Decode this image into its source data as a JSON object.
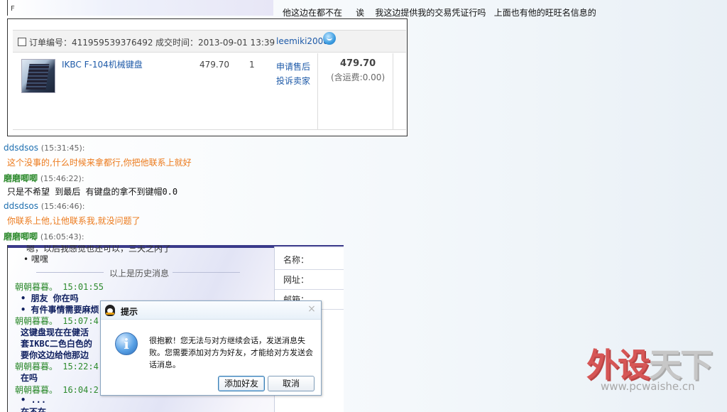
{
  "top": {
    "mark": "F",
    "message": "他这边在都不在     诶    我这边提供我的交易凭证行吗   上面也有他的旺旺名信息的"
  },
  "order": {
    "order_no": "订单编号：411959539376492",
    "deal_time": "成交时间：2013-09-01 13:39",
    "seller": "leemiki2008",
    "item_name": "IKBC F-104机械键盘",
    "price": "479.70",
    "quantity": "1",
    "after_sale_link": "申请售后",
    "complain_link": "投诉卖家",
    "total": "479.70",
    "shipping": "(含运费:0.00)"
  },
  "chat": [
    {
      "name": "ddsdsos",
      "time": "(15:31:45):",
      "message": "这个没事的,什么时候来拿都行,你把他联系上就好",
      "style": "orange",
      "name_style": "blue"
    },
    {
      "name": "磨磨唧唧",
      "time": "(15:46:22):",
      "message": "只是不希望 到最后 有键盘的拿不到键帽0.0",
      "style": "black",
      "name_style": "green"
    },
    {
      "name": "ddsdsos",
      "time": "(15:46:46):",
      "message": "你联系上他,让他联系我,就没问题了",
      "style": "orange",
      "name_style": "blue"
    },
    {
      "name": "磨磨唧唧",
      "time": "(16:05:43):",
      "message": "",
      "style": "black",
      "name_style": "green"
    }
  ],
  "shot": {
    "partial_top": "嗯，以后我感觉也还可以，三天之内了",
    "heihei": "• 嘿嘿",
    "history_label": "以上是历史消息",
    "panel_labels": [
      "名称：",
      "网址：",
      "邮箱："
    ],
    "messages": [
      {
        "text": "朝朝暮暮。    15:01:55",
        "style": "green"
      },
      {
        "text": "• 朋友      你在吗",
        "style": "dark"
      },
      {
        "text": "• 有件事情需要麻烦",
        "style": "dark"
      },
      {
        "text": "朝朝暮暮。    15:07:4",
        "style": "green"
      },
      {
        "text": "  这键盘现在在健活",
        "style": "dark"
      },
      {
        "text": "  套IKBC二色白色的",
        "style": "dark"
      },
      {
        "text": "  要你这边给他那边",
        "style": "dark"
      },
      {
        "text": "朝朝暮暮。    15:22:4",
        "style": "green"
      },
      {
        "text": "  在吗",
        "style": "dark"
      },
      {
        "text": "朝朝暮暮。    16:04:2",
        "style": "green"
      },
      {
        "text": "• ...",
        "style": "dark"
      },
      {
        "text": "  在不在",
        "style": "dark"
      }
    ]
  },
  "dialog": {
    "title": "提示",
    "close": "×",
    "icon": "i",
    "message": "很抱歉！您无法与对方继续会话，发送消息失败。您需要添加对方为好友，才能给对方发送会话消息。",
    "add_friend": "添加好友",
    "cancel": "取消"
  },
  "watermark": {
    "logo_part1": "外设",
    "logo_part2": "天下",
    "url": "www.pcwaishe.cn"
  }
}
